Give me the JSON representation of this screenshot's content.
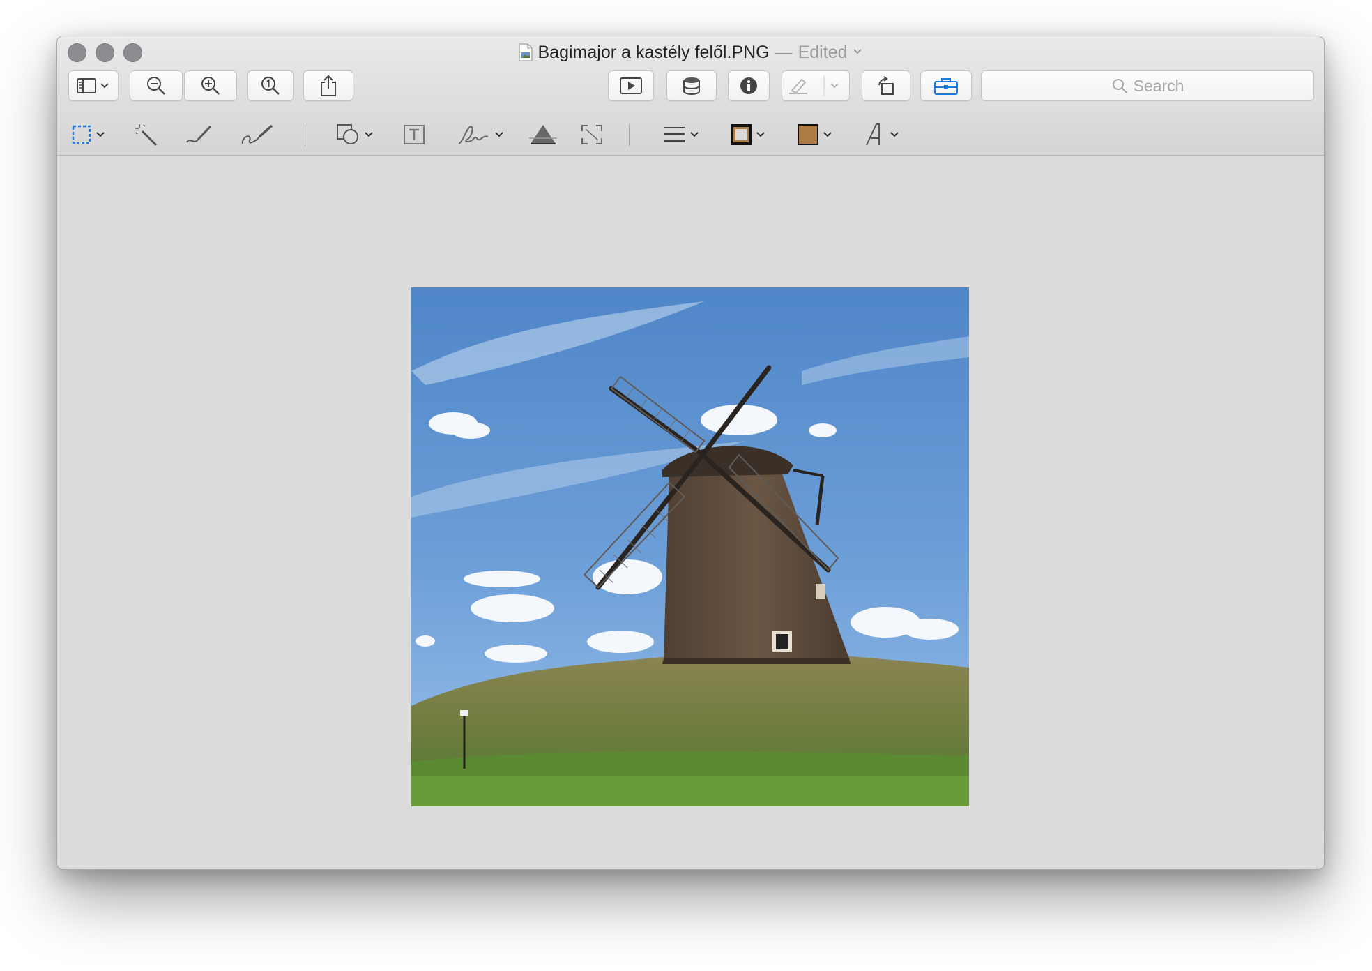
{
  "window": {
    "filename": "Bagimajor a kastély felől.PNG",
    "separator": "—",
    "status": "Edited",
    "status_chevron": "⌄"
  },
  "toolbar": {
    "buttons": [
      {
        "name": "sidebar-toggle-button",
        "icon": "sidebar-icon"
      },
      {
        "name": "zoom-out-button",
        "icon": "zoom-out-icon"
      },
      {
        "name": "zoom-in-button",
        "icon": "zoom-in-icon"
      },
      {
        "name": "actual-size-button",
        "icon": "zoom-actual-size-icon"
      },
      {
        "name": "share-button",
        "icon": "share-icon"
      },
      {
        "name": "slideshow-button",
        "icon": "play-icon"
      },
      {
        "name": "adjust-color-button",
        "icon": "color-adjust-icon"
      },
      {
        "name": "inspector-button",
        "icon": "info-icon"
      },
      {
        "name": "highlight-button",
        "icon": "highlight-icon"
      },
      {
        "name": "rotate-button",
        "icon": "rotate-left-icon"
      },
      {
        "name": "markup-toolbar-button",
        "icon": "toolbox-icon"
      }
    ],
    "search_placeholder": "Search"
  },
  "markup": {
    "tools": [
      "rectangular-selection",
      "instant-alpha",
      "sketch",
      "draw",
      "shapes",
      "text",
      "sign",
      "adjust-color",
      "adjust-size",
      "shape-style",
      "border-color",
      "fill-color",
      "text-style"
    ],
    "accent_color": "#1a7ae0",
    "border_color": "#111111",
    "fill_color": "#ad7b45"
  }
}
